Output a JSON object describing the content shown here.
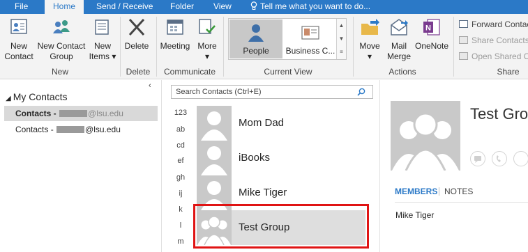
{
  "tabs": {
    "file": "File",
    "home": "Home",
    "send_receive": "Send / Receive",
    "folder": "Folder",
    "view": "View",
    "tell_me": "Tell me what you want to do..."
  },
  "ribbon": {
    "new_contact": [
      "New",
      "Contact"
    ],
    "new_contact_group": [
      "New Contact",
      "Group"
    ],
    "new_items": [
      "New",
      "Items ▾"
    ],
    "group_new": "New",
    "delete": "Delete",
    "group_delete": "Delete",
    "meeting": "Meeting",
    "more": [
      "More",
      "▾"
    ],
    "group_communicate": "Communicate",
    "view_people": "People",
    "view_business_card": "Business C...",
    "group_current_view": "Current View",
    "move": [
      "Move",
      "▾"
    ],
    "mail_merge": [
      "Mail",
      "Merge"
    ],
    "onenote": "OneNote",
    "group_actions": "Actions",
    "forward_contact": "Forward Contact",
    "share_contacts": "Share Contacts",
    "open_shared": "Open Shared Co",
    "group_share": "Share"
  },
  "folders": {
    "heading": "My Contacts",
    "item1_prefix": "Contacts - ",
    "item1_suffix": "@lsu.edu",
    "item2_prefix": "Contacts - ",
    "item2_suffix": "@lsu.edu"
  },
  "search": {
    "placeholder": "Search Contacts (Ctrl+E)"
  },
  "alphabet": [
    "123",
    "ab",
    "cd",
    "ef",
    "gh",
    "ij",
    "k",
    "l",
    "m"
  ],
  "contacts": [
    {
      "name": "Mom Dad"
    },
    {
      "name": "iBooks"
    },
    {
      "name": "Mike Tiger"
    },
    {
      "name": "Test Group"
    }
  ],
  "reading": {
    "name": "Test Gro",
    "members_tab": "MEMBERS",
    "notes_tab": "NOTES",
    "member1": "Mike Tiger"
  },
  "colors": {
    "accent": "#2b79c7",
    "highlight_box": "#e01414",
    "avatar": "#c9c9c9"
  }
}
